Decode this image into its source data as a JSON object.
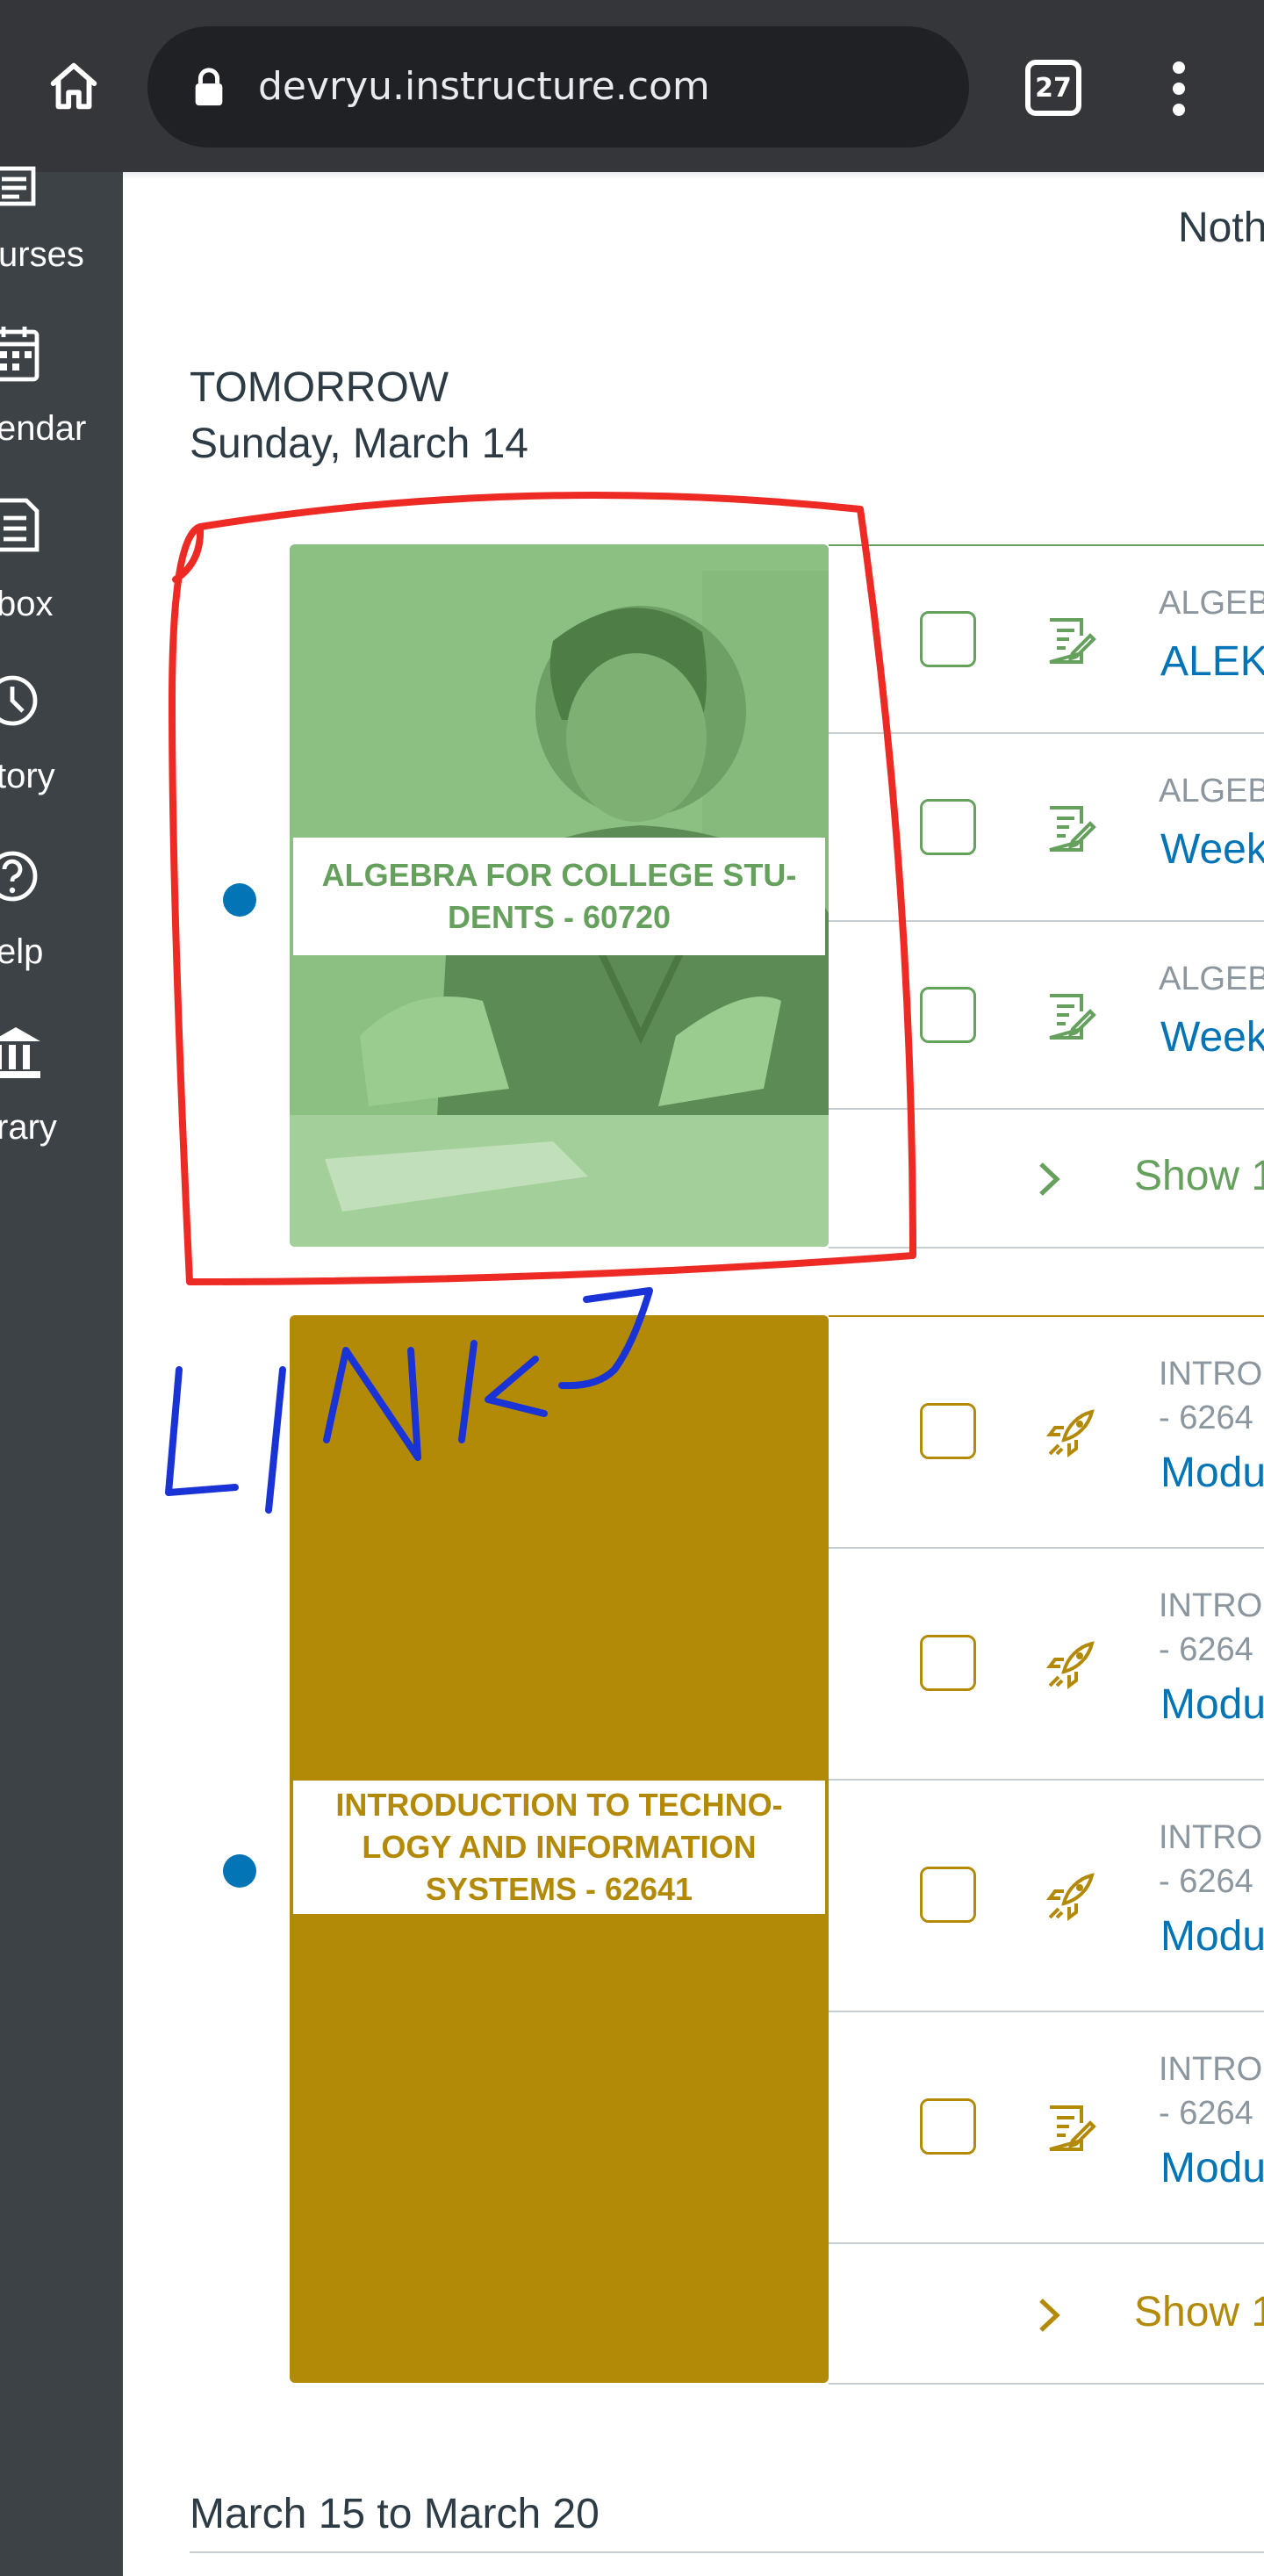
{
  "browser": {
    "url": "devryu.instructure.com",
    "tab_count": "27",
    "icons": [
      "home-icon",
      "lock-icon",
      "tab-switcher-icon",
      "more-vert-icon"
    ]
  },
  "nav": {
    "items": [
      {
        "label": "urses",
        "icon": "courses-icon"
      },
      {
        "label": "endar",
        "icon": "calendar-icon"
      },
      {
        "label": "box",
        "icon": "inbox-icon"
      },
      {
        "label": "tory",
        "icon": "history-icon"
      },
      {
        "label": "elp",
        "icon": "help-icon"
      },
      {
        "label": "rary",
        "icon": "library-icon"
      }
    ]
  },
  "planner": {
    "nothing_text": "Noth",
    "tomorrow_heading": "TOMORROW",
    "tomorrow_date": "Sunday, March 14",
    "next_range": "March 15 to March 20",
    "courses": [
      {
        "card_title": "ALGEBRA FOR COLLEGE STU-DENTS - 60720",
        "color": "#65a05d",
        "items": [
          {
            "context": "ALGEB",
            "title": "ALEK",
            "icon": "assignment-icon"
          },
          {
            "context": "ALGEB",
            "title": "Week",
            "icon": "assignment-icon"
          },
          {
            "context": "ALGEB",
            "title": "Week",
            "icon": "assignment-icon"
          }
        ],
        "show_more": "Show 1"
      },
      {
        "card_title": "INTRODUCTION TO TECHNO-LOGY AND INFORMATION SYSTEMS - 62641",
        "color": "#b38a08",
        "items": [
          {
            "context": "INTRO",
            "context2": "- 6264",
            "title": "Modu",
            "icon": "rocket-icon"
          },
          {
            "context": "INTRO",
            "context2": "- 6264",
            "title": "Modu",
            "icon": "rocket-icon"
          },
          {
            "context": "INTRO",
            "context2": "- 6264",
            "title": "Modu",
            "icon": "rocket-icon"
          },
          {
            "context": "INTRO",
            "context2": "- 6264",
            "title": "Modu",
            "icon": "assignment-icon"
          }
        ],
        "show_more": "Show 1"
      }
    ]
  },
  "annotation": {
    "text": "LINKS",
    "colors": {
      "circle": "#ee2a24",
      "text": "#1a33d6"
    }
  }
}
